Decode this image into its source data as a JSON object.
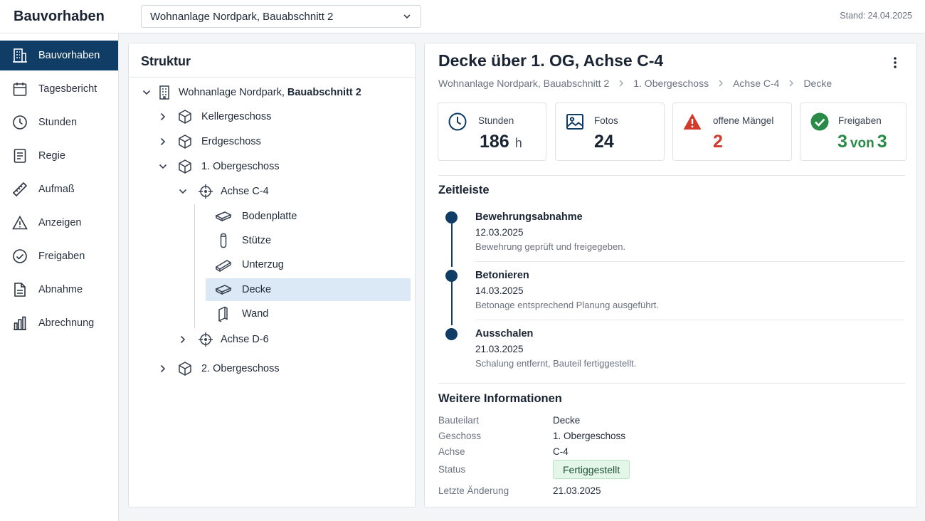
{
  "app": {
    "title": "Bauvorhaben",
    "project_select": "Wohnanlage Nordpark, Bauabschnitt 2",
    "stand_label": "Stand:",
    "stand_date": "24.04.2025"
  },
  "sidebar": {
    "items": [
      {
        "label": "Bauvorhaben",
        "icon": "building-icon",
        "active": true
      },
      {
        "label": "Tagesbericht",
        "icon": "calendar-icon"
      },
      {
        "label": "Stunden",
        "icon": "clock-icon"
      },
      {
        "label": "Regie",
        "icon": "document-icon"
      },
      {
        "label": "Aufmaß",
        "icon": "ruler-icon"
      },
      {
        "label": "Anzeigen",
        "icon": "warning-icon"
      },
      {
        "label": "Freigaben",
        "icon": "check-circle-icon"
      },
      {
        "label": "Abnahme",
        "icon": "file-icon"
      },
      {
        "label": "Abrechnung",
        "icon": "bar-chart-icon"
      }
    ]
  },
  "structure": {
    "title": "Struktur",
    "root_normal": "Wohnanlage Nordpark, ",
    "root_bold": "Bauabschnitt 2",
    "nodes": {
      "keller": "Kellergeschoss",
      "erd": "Erdgeschoss",
      "og1": "1. Obergeschoss",
      "achse_c4": "Achse C-4",
      "bodenplatte": "Bodenplatte",
      "stuetze": "Stütze",
      "unterzug": "Unterzug",
      "decke": "Decke",
      "wand": "Wand",
      "achse_d6": "Achse D-6",
      "og2": "2. Obergeschoss"
    }
  },
  "detail": {
    "title": "Decke über 1. OG, Achse C-4",
    "breadcrumb": [
      "Wohnanlage Nordpark, Bauabschnitt 2",
      "1. Obergeschoss",
      "Achse C-4",
      "Decke"
    ],
    "kpis": {
      "stunden": {
        "label": "Stunden",
        "value": "186",
        "unit": "h"
      },
      "fotos": {
        "label": "Fotos",
        "value": "24"
      },
      "maengel": {
        "label": "offene Mängel",
        "value": "2"
      },
      "freigaben": {
        "label": "Freigaben",
        "value": "3",
        "von": "von",
        "total": "3"
      }
    },
    "timeline_title": "Zeitleiste",
    "timeline": [
      {
        "title": "Bewehrungsabnahme",
        "date": "12.03.2025",
        "desc": "Bewehrung geprüft und freigegeben."
      },
      {
        "title": "Betonieren",
        "date": "14.03.2025",
        "desc": "Betonage entsprechend Planung ausgeführt."
      },
      {
        "title": "Ausschalen",
        "date": "21.03.2025",
        "desc": "Schalung entfernt, Bauteil fertiggestellt."
      }
    ],
    "info_title": "Weitere Informationen",
    "info": {
      "bauteilart_label": "Bauteilart",
      "bauteilart": "Decke",
      "geschoss_label": "Geschoss",
      "geschoss": "1. Obergeschoss",
      "achse_label": "Achse",
      "achse": "C-4",
      "status_label": "Status",
      "status": "Fertiggestellt",
      "aenderung_label": "Letzte Änderung",
      "aenderung": "21.03.2025"
    }
  },
  "colors": {
    "primary": "#0f3d66",
    "danger": "#d23a2b",
    "success": "#2a8a47",
    "selection": "#dbe8f5",
    "badge_bg": "#e3f6e8"
  }
}
